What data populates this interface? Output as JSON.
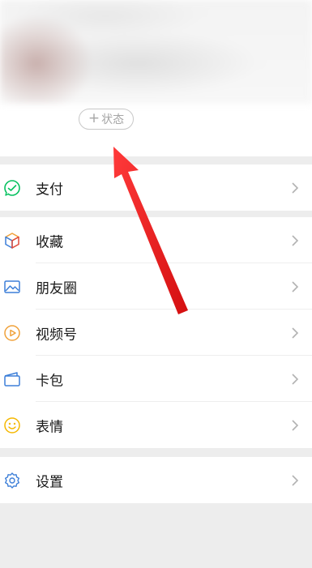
{
  "header": {
    "status_button_plus": "+",
    "status_button_label": "状态"
  },
  "menu": {
    "pay": {
      "label": "支付",
      "icon": "wechat-pay-icon"
    },
    "favorites": {
      "label": "收藏",
      "icon": "cube-icon"
    },
    "moments": {
      "label": "朋友圈",
      "icon": "picture-icon"
    },
    "channels": {
      "label": "视频号",
      "icon": "play-circle-icon"
    },
    "cards": {
      "label": "卡包",
      "icon": "wallet-icon"
    },
    "stickers": {
      "label": "表情",
      "icon": "smiley-icon"
    },
    "settings": {
      "label": "设置",
      "icon": "gear-icon"
    }
  },
  "colors": {
    "annotation_arrow": "#e8191b",
    "pay_green": "#07c160",
    "blue": "#3d7fd8",
    "orange": "#f0a13a",
    "yellow": "#f5b800"
  }
}
